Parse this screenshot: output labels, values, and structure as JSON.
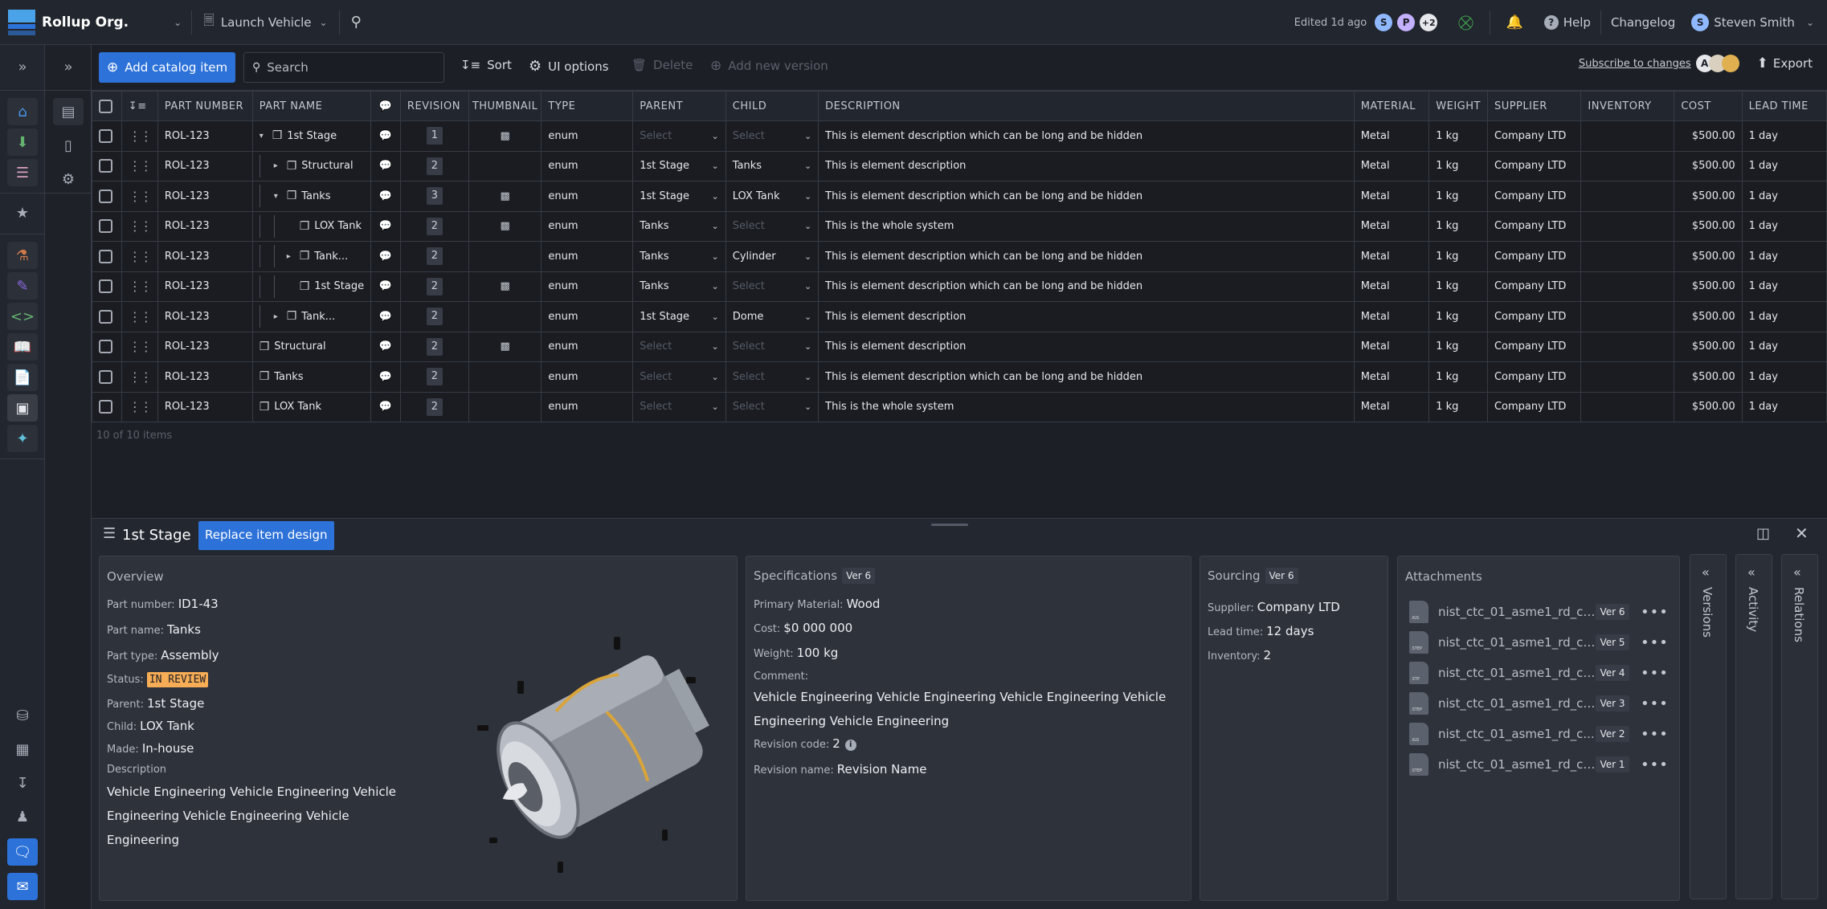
{
  "topbar": {
    "org_name": "Rollup Org.",
    "project_name": "Launch Vehicle",
    "edited": "Edited 1d ago",
    "collaborators": [
      {
        "initial": "S",
        "color": "#8fb8ff"
      },
      {
        "initial": "P",
        "color": "#c3b0ff"
      },
      {
        "initial": "+2",
        "color": "#e6e8ec"
      }
    ],
    "help": "Help",
    "changelog": "Changelog",
    "user_initial": "S",
    "user_name": "Steven Smith"
  },
  "toolbar": {
    "add_label": "Add catalog item",
    "search_placeholder": "Search",
    "sort": "Sort",
    "ui_options": "UI options",
    "delete": "Delete",
    "add_version": "Add new version",
    "subscribe": "Subscribe to changes",
    "subscriber_initial": "A",
    "export": "Export"
  },
  "table": {
    "columns": [
      "PART NUMBER",
      "PART NAME",
      "",
      "REVISION",
      "THUMBNAIL",
      "TYPE",
      "PARENT",
      "CHILD",
      "DESCRIPTION",
      "MATERIAL",
      "WEIGHT",
      "SUPPLIER",
      "INVENTORY",
      "COST",
      "LEAD TIME"
    ],
    "select_placeholder": "Select",
    "rows": [
      {
        "part_number": "ROL-123",
        "part_name": "1st Stage",
        "level": 0,
        "toggle": "▾",
        "revision": "1",
        "thumbnail": true,
        "type": "enum",
        "parent": "",
        "child": "",
        "description": "This is element description which can be long and be hidden",
        "material": "Metal",
        "weight": "1 kg",
        "supplier": "Company LTD",
        "inventory": "",
        "cost": "$500.00",
        "lead_time": "1 day"
      },
      {
        "part_number": "ROL-123",
        "part_name": "Structural",
        "level": 1,
        "toggle": "▸",
        "revision": "2",
        "thumbnail": false,
        "type": "enum",
        "parent": "1st Stage",
        "child": "Tanks",
        "description": "This is element description",
        "material": "Metal",
        "weight": "1 kg",
        "supplier": "Company LTD",
        "inventory": "",
        "cost": "$500.00",
        "lead_time": "1 day"
      },
      {
        "part_number": "ROL-123",
        "part_name": "Tanks",
        "level": 1,
        "toggle": "▾",
        "revision": "3",
        "thumbnail": true,
        "type": "enum",
        "parent": "1st Stage",
        "child": "LOX Tank",
        "description": "This is element description which can be long and be hidden",
        "material": "Metal",
        "weight": "1 kg",
        "supplier": "Company LTD",
        "inventory": "",
        "cost": "$500.00",
        "lead_time": "1 day"
      },
      {
        "part_number": "ROL-123",
        "part_name": "LOX Tank",
        "level": 2,
        "toggle": "",
        "revision": "2",
        "thumbnail": true,
        "type": "enum",
        "parent": "Tanks",
        "child": "",
        "description": "This is the whole system",
        "material": "Metal",
        "weight": "1 kg",
        "supplier": "Company LTD",
        "inventory": "",
        "cost": "$500.00",
        "lead_time": "1 day"
      },
      {
        "part_number": "ROL-123",
        "part_name": "Tank...",
        "level": 2,
        "toggle": "▸",
        "revision": "2",
        "thumbnail": false,
        "type": "enum",
        "parent": "Tanks",
        "child": "Cylinder",
        "description": "This is element description which can be long and be hidden",
        "material": "Metal",
        "weight": "1 kg",
        "supplier": "Company LTD",
        "inventory": "",
        "cost": "$500.00",
        "lead_time": "1 day"
      },
      {
        "part_number": "ROL-123",
        "part_name": "1st Stage",
        "level": 2,
        "toggle": "",
        "revision": "2",
        "thumbnail": true,
        "type": "enum",
        "parent": "Tanks",
        "child": "",
        "description": "This is element description which can be long and be hidden",
        "material": "Metal",
        "weight": "1 kg",
        "supplier": "Company LTD",
        "inventory": "",
        "cost": "$500.00",
        "lead_time": "1 day"
      },
      {
        "part_number": "ROL-123",
        "part_name": "Tank...",
        "level": 1,
        "toggle": "▸",
        "revision": "2",
        "thumbnail": false,
        "type": "enum",
        "parent": "1st Stage",
        "child": "Dome",
        "description": "This is element description",
        "material": "Metal",
        "weight": "1 kg",
        "supplier": "Company LTD",
        "inventory": "",
        "cost": "$500.00",
        "lead_time": "1 day"
      },
      {
        "part_number": "ROL-123",
        "part_name": "Structural",
        "level": -1,
        "toggle": "",
        "revision": "2",
        "thumbnail": true,
        "type": "enum",
        "parent": "",
        "child": "",
        "description": "This is element description",
        "material": "Metal",
        "weight": "1 kg",
        "supplier": "Company LTD",
        "inventory": "",
        "cost": "$500.00",
        "lead_time": "1 day"
      },
      {
        "part_number": "ROL-123",
        "part_name": "Tanks",
        "level": -1,
        "toggle": "",
        "revision": "2",
        "thumbnail": false,
        "type": "enum",
        "parent": "",
        "child": "",
        "description": "This is element description which can be long and be hidden",
        "material": "Metal",
        "weight": "1 kg",
        "supplier": "Company LTD",
        "inventory": "",
        "cost": "$500.00",
        "lead_time": "1 day"
      },
      {
        "part_number": "ROL-123",
        "part_name": "LOX Tank",
        "level": -1,
        "toggle": "",
        "revision": "2",
        "thumbnail": false,
        "type": "enum",
        "parent": "",
        "child": "",
        "description": "This is the whole system",
        "material": "Metal",
        "weight": "1 kg",
        "supplier": "Company LTD",
        "inventory": "",
        "cost": "$500.00",
        "lead_time": "1 day"
      }
    ],
    "count_label": "10 of 10 items"
  },
  "detail": {
    "title": "1st Stage",
    "replace_button": "Replace item design",
    "overview": {
      "heading": "Overview",
      "part_number_label": "Part number:",
      "part_number": "ID1-43",
      "part_name_label": "Part name:",
      "part_name": "Tanks",
      "part_type_label": "Part type:",
      "part_type": "Assembly",
      "status_label": "Status:",
      "status": "IN REVIEW",
      "status_color": "#f7ad55",
      "parent_label": "Parent:",
      "parent": "1st Stage",
      "child_label": "Child:",
      "child": "LOX Tank",
      "made_label": "Made:",
      "made": "In-house",
      "description_label": "Description",
      "description": "Vehicle Engineering Vehicle Engineering Vehicle Engineering Vehicle Engineering Vehicle Engineering"
    },
    "specifications": {
      "heading": "Specifications",
      "version": "Ver 6",
      "material_label": "Primary Material:",
      "material": "Wood",
      "cost_label": "Cost:",
      "cost": "$0 000 000",
      "weight_label": "Weight:",
      "weight": "100 kg",
      "comment_label": "Comment:",
      "comment": "Vehicle Engineering Vehicle Engineering Vehicle Engineering Vehicle Engineering Vehicle Engineering",
      "revision_code_label": "Revision code:",
      "revision_code": "2",
      "revision_name_label": "Revision name:",
      "revision_name": "Revision Name"
    },
    "sourcing": {
      "heading": "Sourcing",
      "version": "Ver 6",
      "supplier_label": "Supplier:",
      "supplier": "Company LTD",
      "lead_time_label": "Lead time:",
      "lead_time": "12 days",
      "inventory_label": "Inventory:",
      "inventory": "2"
    },
    "attachments": {
      "heading": "Attachments",
      "files": [
        {
          "name": "nist_ctc_01_asme1_rd_ct...",
          "ext": ".IGS",
          "version": "Ver 6"
        },
        {
          "name": "nist_ctc_01_asme1_rd_ct...",
          "ext": ".STEP",
          "version": "Ver 5"
        },
        {
          "name": "nist_ctc_01_asme1_rd_ct...",
          "ext": ".STP",
          "version": "Ver 4"
        },
        {
          "name": "nist_ctc_01_asme1_rd_ct...",
          "ext": ".STEP",
          "version": "Ver 3"
        },
        {
          "name": "nist_ctc_01_asme1_rd_c...",
          "ext": ".IGS",
          "version": "Ver 2"
        },
        {
          "name": "nist_ctc_01_asme1_rd_ct...",
          "ext": ".STEP",
          "version": "Ver 1"
        }
      ]
    },
    "side_tabs": [
      "Versions",
      "Activity",
      "Relations"
    ]
  }
}
